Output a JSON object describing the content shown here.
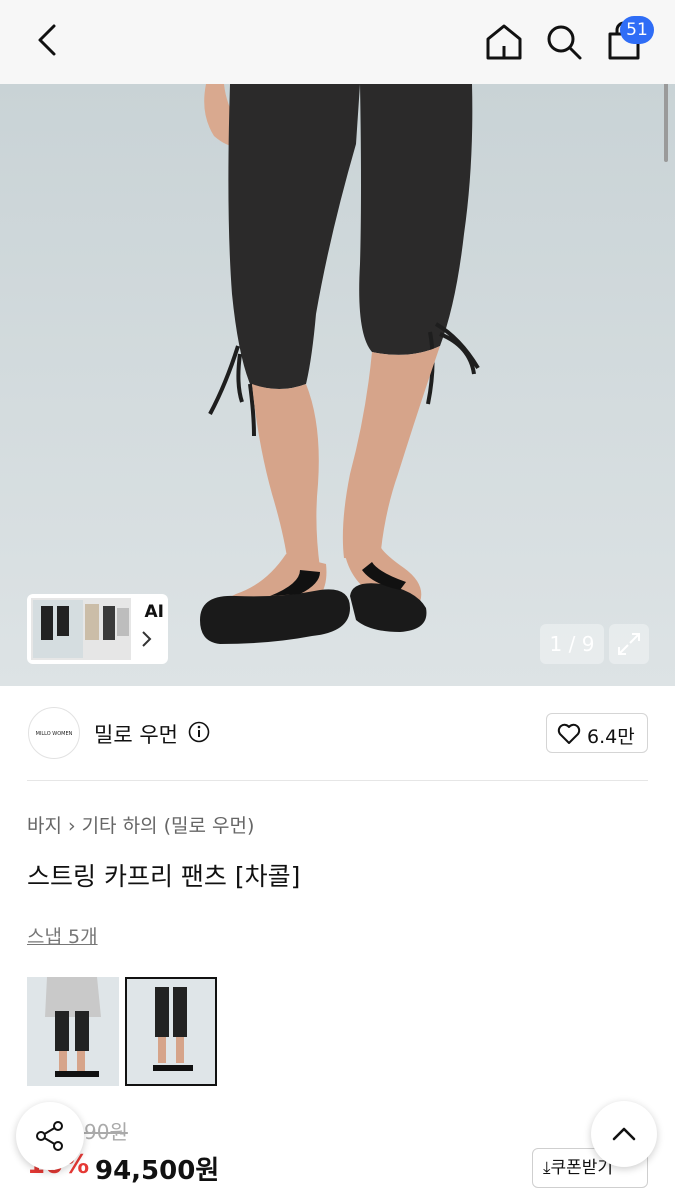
{
  "header": {
    "cart_count": "51"
  },
  "gallery": {
    "ai_label": "AI",
    "page_indicator": "1 / 9"
  },
  "brand": {
    "logo_text": "MILLO WOMEN",
    "name": "밀로 우먼",
    "likes": "6.4만"
  },
  "product": {
    "breadcrumb": [
      "바지",
      "기타 하의 (밀로 우먼)"
    ],
    "title": "스트링 카프리 팬츠 [차콜]",
    "snap_link": "스냅 5개",
    "original_price": "90원",
    "discount": "10%",
    "price": "94,500원",
    "coupon_button": "⤓쿠폰받기"
  },
  "colors": {
    "accent_badge": "#2f6df6",
    "discount_red": "#e53935"
  },
  "icons": [
    "back-icon",
    "home-icon",
    "search-icon",
    "shopping-bag-icon",
    "expand-icon",
    "info-icon",
    "heart-icon",
    "share-icon",
    "chevron-up-icon"
  ]
}
